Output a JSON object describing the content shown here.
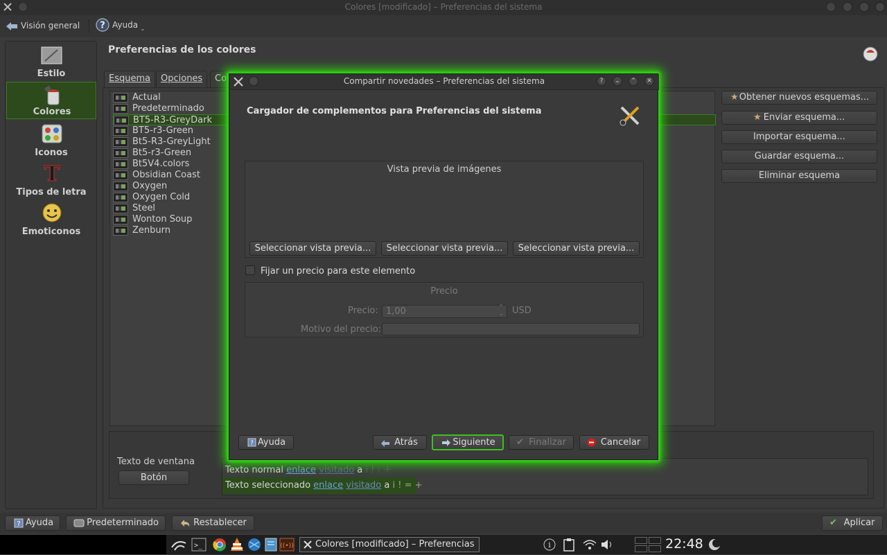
{
  "window": {
    "title": "Colores [modificado] – Preferencias del sistema"
  },
  "toolbar": {
    "overview_label": "Visión general",
    "help_label": "Ayuda"
  },
  "sidebar": {
    "items": [
      {
        "label": "Estilo",
        "icon": "style-icon"
      },
      {
        "label": "Colores",
        "icon": "colors-icon"
      },
      {
        "label": "Iconos",
        "icon": "icons-icon"
      },
      {
        "label": "Tipos de letra",
        "icon": "fonts-icon"
      },
      {
        "label": "Emoticonos",
        "icon": "emoticons-icon"
      }
    ],
    "active_index": 1
  },
  "content": {
    "title": "Preferencias de los colores",
    "tabs": [
      {
        "label": "Esquema"
      },
      {
        "label": "Opciones"
      },
      {
        "label": "Col"
      }
    ],
    "schemes": [
      "Actual",
      "Predeterminado",
      "BT5-R3-GreyDark",
      "BT5-r3-Green",
      "Bt5-R3-GreyLight",
      "Bt5-r3-Green",
      "Bt5V4.colors",
      "Obsidian Coast",
      "Oxygen",
      "Oxygen Cold",
      "Steel",
      "Wonton Soup",
      "Zenburn"
    ],
    "selected_scheme_index": 2,
    "actions": {
      "get_new": "Obtener nuevos esquemas...",
      "upload": "Enviar esquema...",
      "import": "Importar esquema...",
      "save": "Guardar esquema...",
      "delete": "Eliminar esquema"
    },
    "preview": {
      "window_text": "Texto de ventana",
      "button": "Botón",
      "normal_text": "Texto normal",
      "selected_text": "Texto seleccionado",
      "link": "enlace",
      "visited": "visitado",
      "a": "a",
      "row1_tail": "i ! ⁝ ＋",
      "row2_tail": "i ! = +"
    }
  },
  "bottom": {
    "help": "Ayuda",
    "defaults": "Predeterminado",
    "reset": "Restablecer",
    "apply": "Aplicar"
  },
  "dialog": {
    "title": "Compartir novedades – Preferencias del sistema",
    "heading": "Cargador de complementos para Preferencias del sistema",
    "preview_group_title": "Vista previa de imágenes",
    "select_preview_1": "Seleccionar vista previa...",
    "select_preview_2": "Seleccionar vista previa...",
    "select_preview_3": "Seleccionar vista previa...",
    "price_checkbox": "Fijar un precio para este elemento",
    "price_checked": false,
    "price_group_title": "Precio",
    "price_label": "Precio:",
    "price_value": "1,00",
    "price_currency": "USD",
    "price_reason_label": "Motivo del precio:",
    "price_reason_value": "",
    "help": "Ayuda",
    "back": "Atrás",
    "next": "Siguiente",
    "finish": "Finalizar",
    "cancel": "Cancelar"
  },
  "taskbar": {
    "task_label": "Colores [modificado] – Preferencias d",
    "clock": "22:48"
  },
  "colors": {
    "accent_green": "#3dff1c",
    "selection_green": "#2c4a1c",
    "link_blue": "#6aa0d8"
  }
}
